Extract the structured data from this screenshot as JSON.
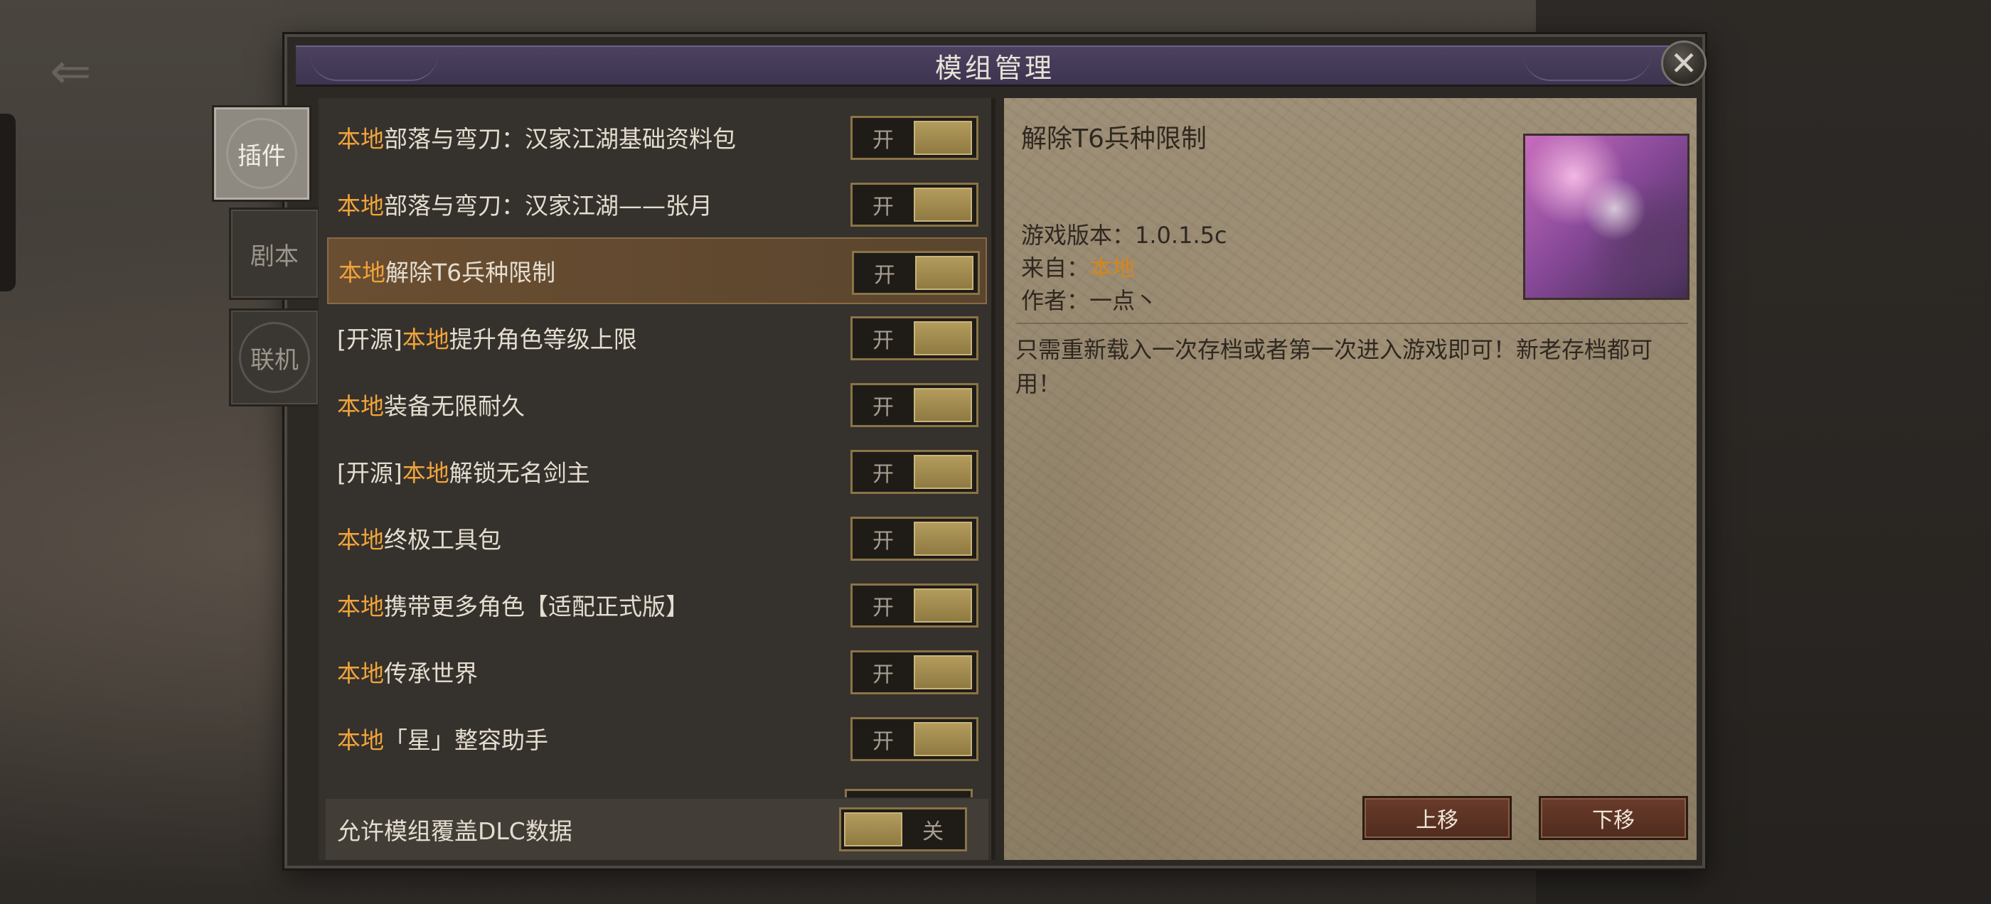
{
  "dialog": {
    "title": "模组管理",
    "close_icon": "close-icon"
  },
  "tabs": [
    {
      "label": "插件",
      "active": true
    },
    {
      "label": "剧本",
      "active": false
    },
    {
      "label": "联机",
      "active": false
    }
  ],
  "mods": [
    {
      "prefix": "",
      "source": "本地",
      "name": "部落与弯刀：汉家江湖基础资料包",
      "toggle": "开",
      "selected": false
    },
    {
      "prefix": "",
      "source": "本地",
      "name": "部落与弯刀：汉家江湖——张月",
      "toggle": "开",
      "selected": false
    },
    {
      "prefix": "",
      "source": "本地",
      "name": "解除T6兵种限制",
      "toggle": "开",
      "selected": true
    },
    {
      "prefix": "[开源]",
      "source": "本地",
      "name": "提升角色等级上限",
      "toggle": "开",
      "selected": false
    },
    {
      "prefix": "",
      "source": "本地",
      "name": "装备无限耐久",
      "toggle": "开",
      "selected": false
    },
    {
      "prefix": "[开源]",
      "source": "本地",
      "name": "解锁无名剑主",
      "toggle": "开",
      "selected": false
    },
    {
      "prefix": "",
      "source": "本地",
      "name": "终极工具包",
      "toggle": "开",
      "selected": false
    },
    {
      "prefix": "",
      "source": "本地",
      "name": "携带更多角色【适配正式版】",
      "toggle": "开",
      "selected": false
    },
    {
      "prefix": "",
      "source": "本地",
      "name": "传承世界",
      "toggle": "开",
      "selected": false
    },
    {
      "prefix": "",
      "source": "本地",
      "name": "「星」整容助手",
      "toggle": "开",
      "selected": false
    }
  ],
  "dlc": {
    "label": "允许模组覆盖DLC数据",
    "toggle": "关"
  },
  "detail": {
    "title": "解除T6兵种限制",
    "version_label": "游戏版本：",
    "version_value": "1.0.1.5c",
    "from_label": "来自：",
    "from_value": "本地",
    "author_label": "作者：",
    "author_value": "一点丶",
    "description": "只需重新载入一次存档或者第一次进入游戏即可！新老存档都可用！",
    "move_up": "上移",
    "move_down": "下移"
  },
  "colors": {
    "source_tag": "#f0a33c",
    "toggle_border": "#8a7446",
    "selected_row": "#6a4e31"
  }
}
